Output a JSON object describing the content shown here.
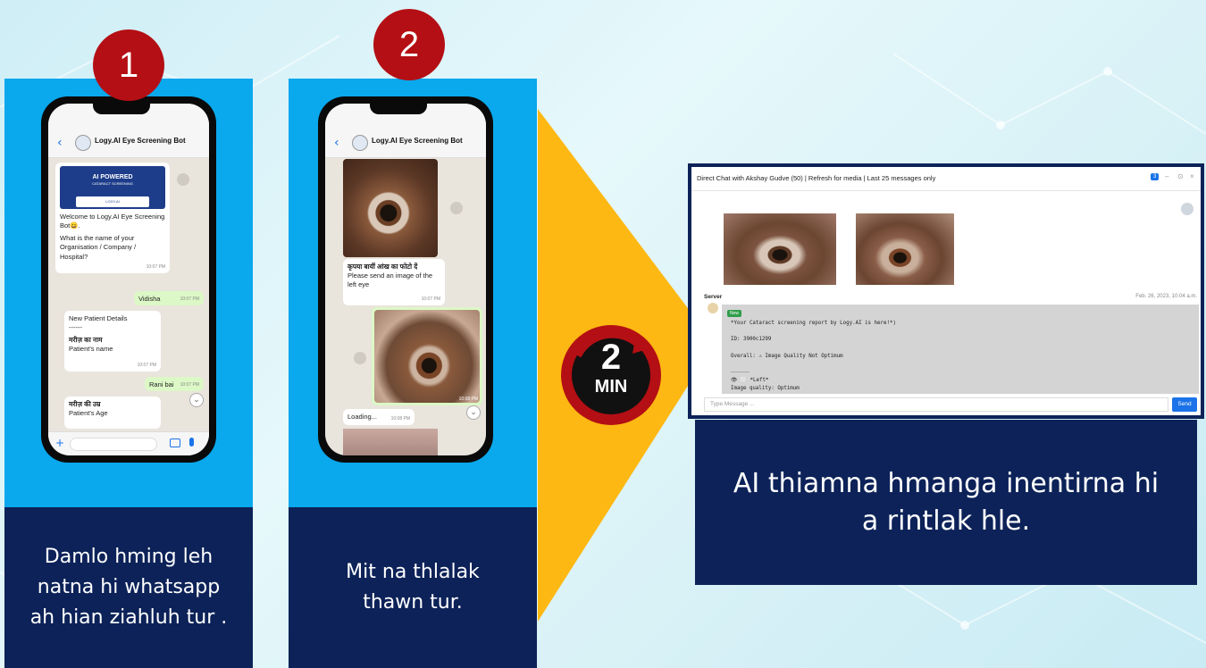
{
  "steps": [
    {
      "number": "1",
      "caption": "Damlo hming leh natna hi whatsapp ah hian ziahluh tur .",
      "chat": {
        "title": "Logy.AI Eye Screening Bot",
        "banner_title": "AI POWERED",
        "banner_sub": "CATARACT SCREENING",
        "banner_logo": "LOGY.AI",
        "welcome": "Welcome to Logy.AI Eye Screening Bot😀.",
        "question": "What is the name of your Organisation / Company / Hospital?",
        "time1": "10:07 PM",
        "reply1": "Vidisha",
        "time2": "10:07 PM",
        "details_title": "New Patient Details",
        "details_sep": "------",
        "name_hi": "मरीज़ का नाम",
        "name_en": "Patient's name",
        "time3": "10:07 PM",
        "reply2": "Rani bai",
        "time4": "10:07 PM",
        "age_hi": "मरीज़ की उम्र",
        "age_en": "Patient's Age"
      }
    },
    {
      "number": "2",
      "caption": "Mit na thlalak thawn tur.",
      "chat": {
        "title": "Logy.AI Eye Screening Bot",
        "prompt_hi": "कृपया बायीं आंख का फोटो दें",
        "prompt_en": "Please send an image of the left eye",
        "time1": "10:07 PM",
        "time2": "10:08 PM",
        "loading": "Loading...",
        "time3": "10:08 PM"
      }
    }
  ],
  "timer": {
    "value": "2",
    "unit": "MIN"
  },
  "result": {
    "header": "Direct Chat with Akshay Gudve (50) | Refresh for media | Last 25 messages only",
    "badge_count": "3",
    "sender": "Server",
    "timestamp": "Feb. 26, 2023, 10:04 a.m.",
    "new_tag": "New",
    "line1": "*Your Cataract screening report by Logy.AI is here!*)",
    "line2": "ID: 3900c1299",
    "line3": "Overall: ⚠ Image Quality Not Optimum",
    "line4": "______",
    "line5": "👁 ⬜ *Left*",
    "line6": "Image quality: Optimum",
    "input_placeholder": "Type Message ...",
    "send_label": "Send",
    "caption": "AI thiamna hmanga inentirna hi a rintlak hle."
  },
  "colors": {
    "panel": "#0aa8ec",
    "caption_bg": "#0c2258",
    "badge": "#b40f14",
    "arrow": "#fdb813",
    "timer": "#b40f14"
  }
}
